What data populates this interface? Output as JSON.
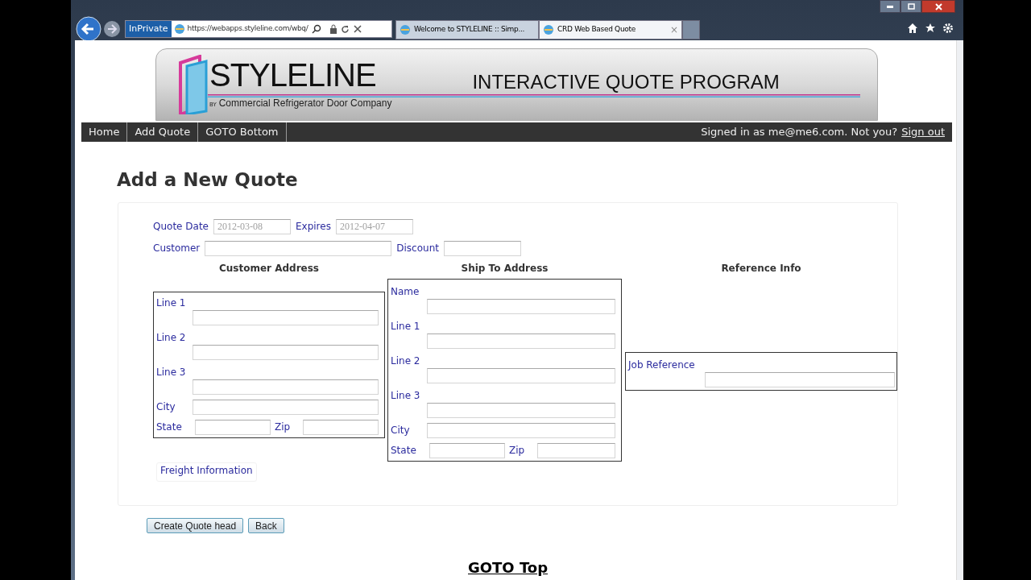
{
  "browser": {
    "private_badge": "InPrivate",
    "address": "https://webapps.styleline.com/wbq/",
    "tabs": [
      {
        "title": "Welcome to STYLELINE :: Simp...",
        "selected": false
      },
      {
        "title": "CRD Web Based Quote",
        "selected": true,
        "close": "×"
      }
    ]
  },
  "banner": {
    "logo": "STYLELINE",
    "by": "BY",
    "company": "Commercial Refrigerator Door Company",
    "program": "INTERACTIVE QUOTE PROGRAM"
  },
  "nav": {
    "items": [
      "Home",
      "Add Quote",
      "GOTO Bottom"
    ],
    "signed_in": "Signed in as me@me6.com. Not you?",
    "sign_out": "Sign out"
  },
  "heading": "Add a New Quote",
  "form": {
    "quote_date": {
      "label": "Quote Date",
      "value": "2012-03-08",
      "disabled": true
    },
    "expires": {
      "label": "Expires",
      "value": "2012-04-07",
      "disabled": true
    },
    "customer": {
      "label": "Customer"
    },
    "discount": {
      "label": "Discount"
    },
    "customer_address": {
      "title": "Customer Address",
      "fields": [
        {
          "kind": "stacked",
          "label": "Line 1"
        },
        {
          "kind": "stacked",
          "label": "Line 2"
        },
        {
          "kind": "stacked",
          "label": "Line 3"
        },
        {
          "kind": "inline",
          "label": "City"
        },
        {
          "kind": "pair",
          "label": "State",
          "label2": "Zip"
        }
      ]
    },
    "ship_to_address": {
      "title": "Ship To Address",
      "fields": [
        {
          "kind": "stacked",
          "label": "Name"
        },
        {
          "kind": "stacked",
          "label": "Line 1"
        },
        {
          "kind": "stacked",
          "label": "Line 2"
        },
        {
          "kind": "stacked",
          "label": "Line 3"
        },
        {
          "kind": "inline",
          "label": "City"
        },
        {
          "kind": "pair",
          "label": "State",
          "label2": "Zip"
        }
      ]
    },
    "reference_info": {
      "title": "Reference Info",
      "job_reference": "Job Reference"
    },
    "freight": "Freight Information"
  },
  "buttons": [
    "Create Quote head",
    "Back"
  ],
  "goto_top": "GOTO Top"
}
